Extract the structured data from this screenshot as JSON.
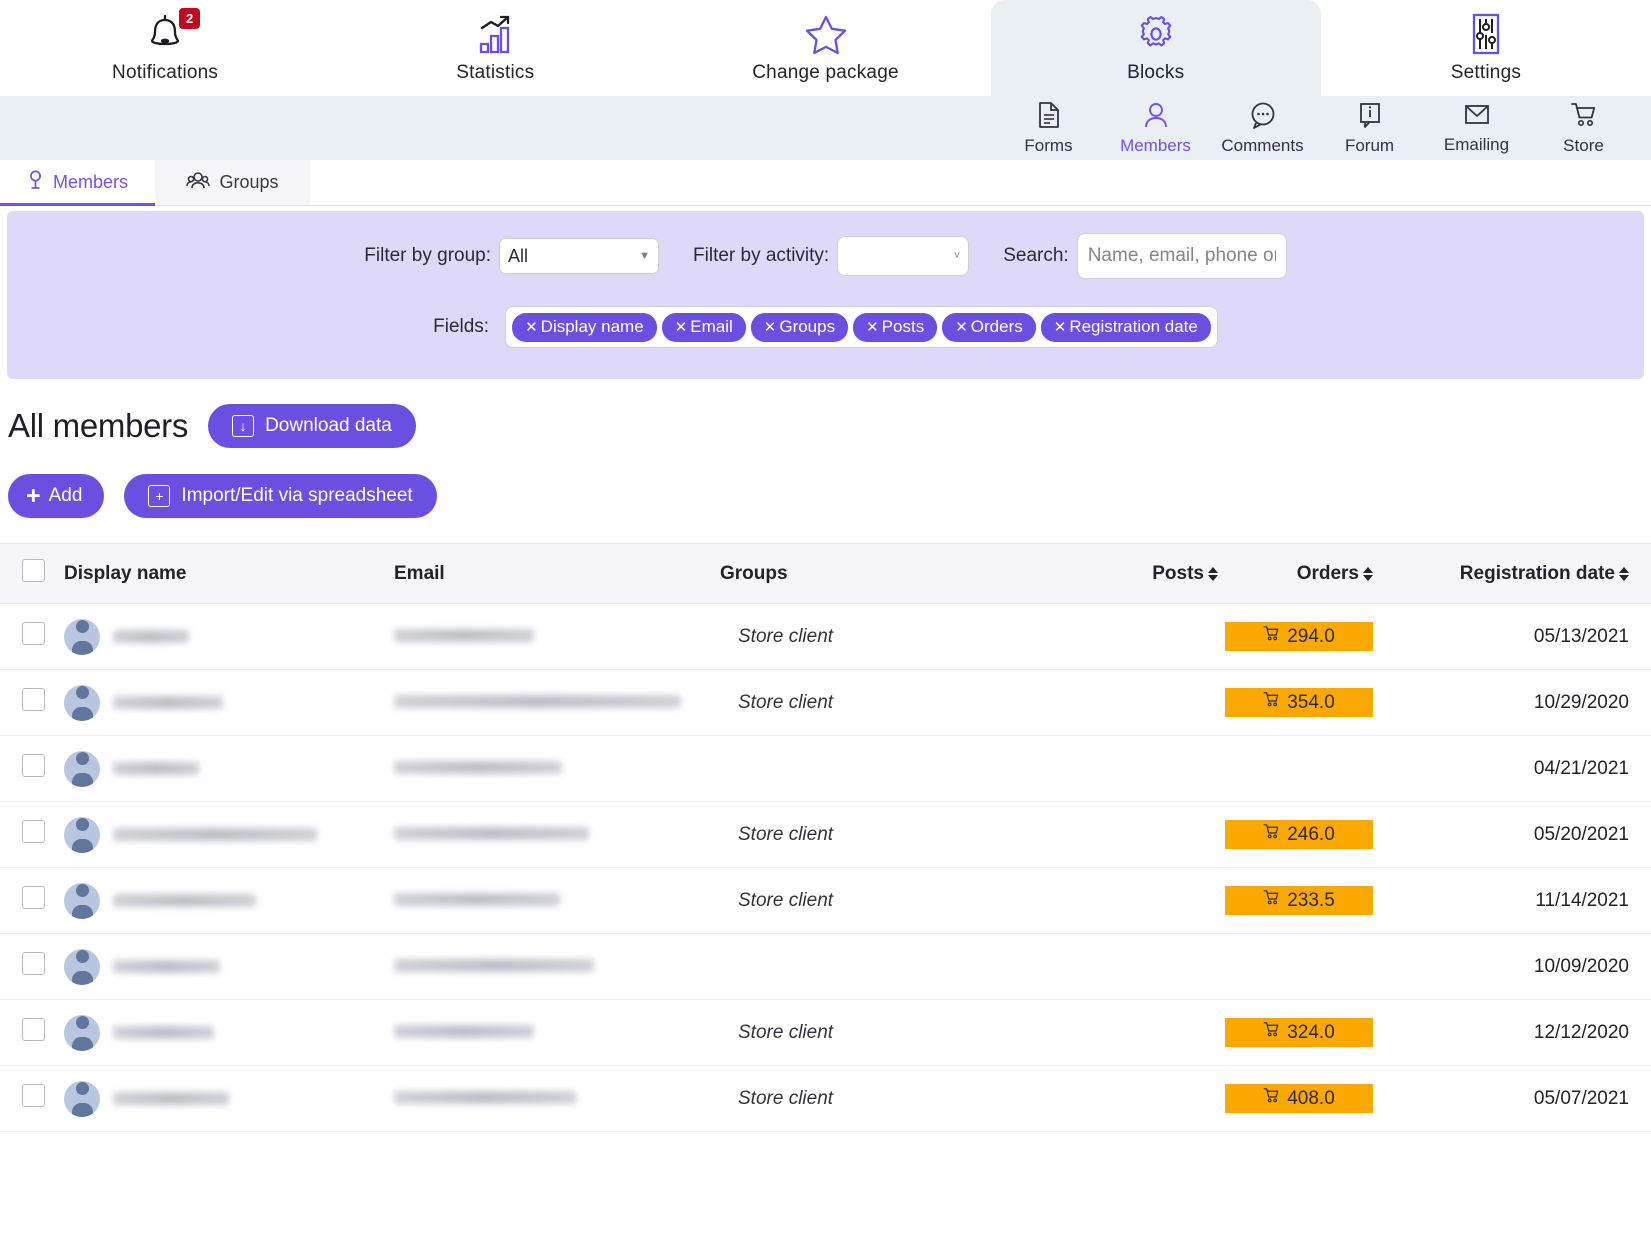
{
  "topnav": {
    "items": [
      {
        "label": "Notifications",
        "icon": "bell-icon",
        "badge": "2",
        "active": false
      },
      {
        "label": "Statistics",
        "icon": "chart-bar-icon",
        "badge": null,
        "active": false
      },
      {
        "label": "Change package",
        "icon": "star-icon",
        "badge": null,
        "active": false
      },
      {
        "label": "Blocks",
        "icon": "gear-icon",
        "badge": null,
        "active": true
      },
      {
        "label": "Settings",
        "icon": "sliders-icon",
        "badge": null,
        "active": false
      }
    ]
  },
  "subnav": {
    "items": [
      {
        "label": "Forms",
        "icon": "document-icon",
        "active": false
      },
      {
        "label": "Members",
        "icon": "person-icon",
        "active": true
      },
      {
        "label": "Comments",
        "icon": "comment-icon",
        "active": false
      },
      {
        "label": "Forum",
        "icon": "info-bubble-icon",
        "active": false
      },
      {
        "label": "Emailing",
        "icon": "envelope-icon",
        "active": false
      },
      {
        "label": "Store",
        "icon": "cart-icon",
        "active": false
      }
    ]
  },
  "tabs": [
    {
      "label": "Members",
      "icon": "person-pin-icon",
      "active": true
    },
    {
      "label": "Groups",
      "icon": "people-icon",
      "active": false
    }
  ],
  "filters": {
    "group_label": "Filter by group:",
    "group_value": "All",
    "activity_label": "Filter by activity:",
    "activity_value": "",
    "search_label": "Search:",
    "search_value": "",
    "search_placeholder": "Name, email, phone or city",
    "fields_label": "Fields:",
    "fields": [
      "Display name",
      "Email",
      "Groups",
      "Posts",
      "Orders",
      "Registration date"
    ]
  },
  "section": {
    "title": "All members",
    "download_label": "Download data",
    "download_icon": "download-icon",
    "add_label": "Add",
    "add_icon": "plus-icon",
    "import_label": "Import/Edit via spreadsheet",
    "import_icon": "spreadsheet-add-icon"
  },
  "table": {
    "columns": [
      {
        "key": "check",
        "label": "",
        "sortable": false
      },
      {
        "key": "name",
        "label": "Display name",
        "sortable": false
      },
      {
        "key": "email",
        "label": "Email",
        "sortable": false
      },
      {
        "key": "groups",
        "label": "Groups",
        "sortable": false
      },
      {
        "key": "posts",
        "label": "Posts",
        "sortable": true
      },
      {
        "key": "orders",
        "label": "Orders",
        "sortable": true
      },
      {
        "key": "registration",
        "label": "Registration date",
        "sortable": true
      }
    ],
    "rows": [
      {
        "name": "",
        "email": "",
        "groups": "Store client",
        "posts": "",
        "orders": "294.0",
        "registration": "05/13/2021",
        "name_w": 76,
        "email_w": 140
      },
      {
        "name": "",
        "email": "",
        "groups": "Store client",
        "posts": "",
        "orders": "354.0",
        "registration": "10/29/2020",
        "name_w": 110,
        "email_w": 287
      },
      {
        "name": "",
        "email": "",
        "groups": "",
        "posts": "",
        "orders": "",
        "registration": "04/21/2021",
        "name_w": 86,
        "email_w": 168
      },
      {
        "name": "",
        "email": "",
        "groups": "Store client",
        "posts": "",
        "orders": "246.0",
        "registration": "05/20/2021",
        "name_w": 204,
        "email_w": 195
      },
      {
        "name": "",
        "email": "",
        "groups": "Store client",
        "posts": "",
        "orders": "233.5",
        "registration": "11/14/2021",
        "name_w": 143,
        "email_w": 166
      },
      {
        "name": "",
        "email": "",
        "groups": "",
        "posts": "",
        "orders": "",
        "registration": "10/09/2020",
        "name_w": 107,
        "email_w": 200
      },
      {
        "name": "",
        "email": "",
        "groups": "Store client",
        "posts": "",
        "orders": "324.0",
        "registration": "12/12/2020",
        "name_w": 101,
        "email_w": 140
      },
      {
        "name": "",
        "email": "",
        "groups": "Store client",
        "posts": "",
        "orders": "408.0",
        "registration": "05/07/2021",
        "name_w": 116,
        "email_w": 182
      }
    ],
    "order_icon": "cart-icon"
  },
  "colors": {
    "accent": "#6b4fe0",
    "accent_light": "#7551e9",
    "filter_panel": "#ded9f9",
    "order_badge": "#fba900",
    "badge_red": "#c2091e",
    "subnav_bg": "#eaeff3"
  }
}
